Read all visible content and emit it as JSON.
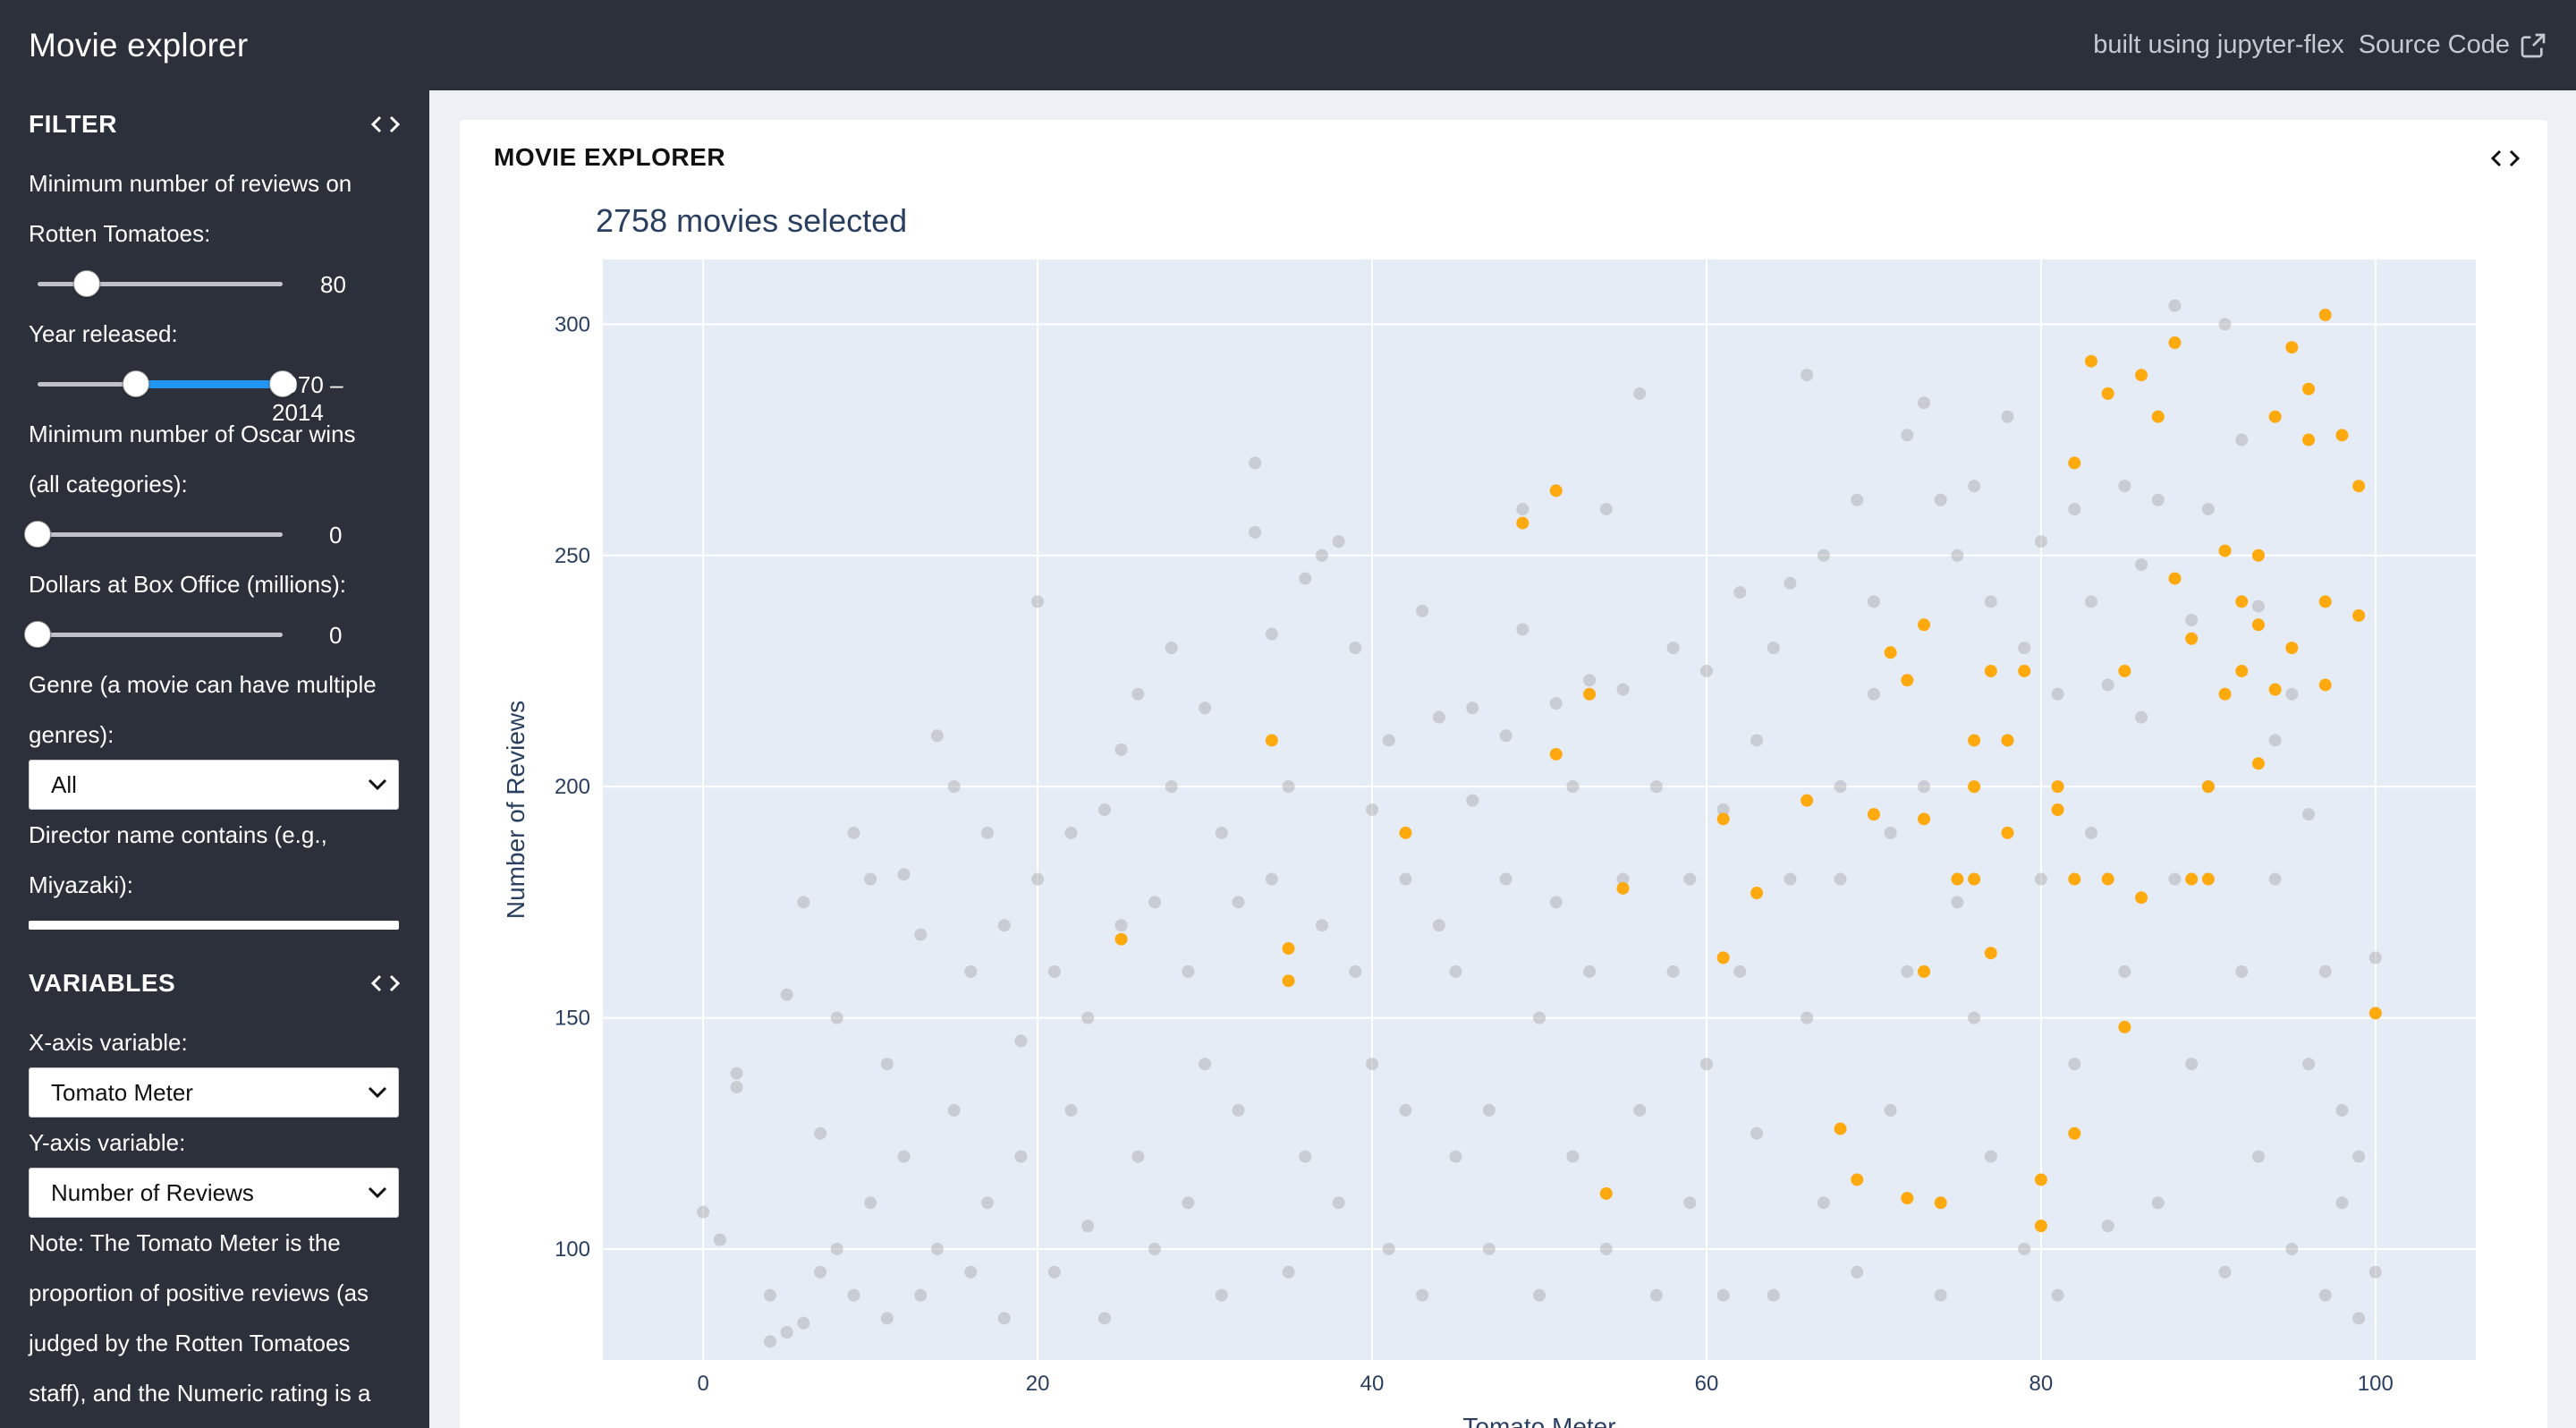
{
  "header": {
    "title": "Movie explorer",
    "built_using": "built using jupyter-flex",
    "source_code": "Source Code"
  },
  "sidebar": {
    "filter": {
      "heading": "FILTER",
      "reviews_label_1": "Minimum number of reviews on",
      "reviews_label_2": "Rotten Tomatoes:",
      "reviews_value": "80",
      "reviews_fraction": 0.2,
      "year_label": "Year released:",
      "year_value": "1970 – 2014",
      "year_low_fraction": 0.4,
      "year_high_fraction": 1.0,
      "oscars_label_1": "Minimum number of Oscar wins",
      "oscars_label_2": "(all categories):",
      "oscars_value": "0",
      "oscars_fraction": 0,
      "boxoffice_label": "Dollars at Box Office (millions):",
      "boxoffice_value": "0",
      "boxoffice_fraction": 0,
      "genre_label_1": "Genre (a movie can have multiple",
      "genre_label_2": "genres):",
      "genre_value": "All",
      "director_label_1": "Director name contains (e.g.,",
      "director_label_2": "Miyazaki):",
      "director_value": ""
    },
    "variables": {
      "heading": "VARIABLES",
      "x_label": "X-axis variable:",
      "x_value": "Tomato Meter",
      "y_label": "Y-axis variable:",
      "y_value": "Number of Reviews",
      "note_1": "Note: The Tomato Meter is the",
      "note_2": "proportion of positive reviews (as",
      "note_3": "judged by the Rotten Tomatoes",
      "note_4": "staff), and the Numeric rating is a"
    }
  },
  "main": {
    "card_title": "MOVIE EXPLORER",
    "plot_title": "2758 movies selected"
  },
  "colors": {
    "topbar": "#2b303b",
    "plot_bg": "#e5ecf6",
    "point_grey": "#a6a6a6",
    "point_orange": "#ffa500",
    "slider_fill": "#2196f3"
  },
  "chart_data": {
    "type": "scatter",
    "title": "2758 movies selected",
    "xlabel": "Tomato Meter",
    "ylabel": "Number of Reviews",
    "xlim": [
      -6,
      106
    ],
    "ylim": [
      76,
      314
    ],
    "xticks": [
      0,
      20,
      40,
      60,
      80,
      100
    ],
    "yticks": [
      100,
      150,
      200,
      250,
      300
    ],
    "grid": true,
    "series": [
      {
        "color": "#a6a6a6",
        "points": [
          [
            0,
            108
          ],
          [
            1,
            102
          ],
          [
            2,
            135
          ],
          [
            2,
            138
          ],
          [
            4,
            90
          ],
          [
            4,
            80
          ],
          [
            5,
            82
          ],
          [
            5,
            155
          ],
          [
            6,
            84
          ],
          [
            6,
            175
          ],
          [
            7,
            95
          ],
          [
            7,
            125
          ],
          [
            8,
            100
          ],
          [
            8,
            150
          ],
          [
            9,
            90
          ],
          [
            9,
            190
          ],
          [
            10,
            110
          ],
          [
            10,
            180
          ],
          [
            11,
            85
          ],
          [
            11,
            140
          ],
          [
            12,
            120
          ],
          [
            12,
            181
          ],
          [
            13,
            168
          ],
          [
            13,
            90
          ],
          [
            14,
            211
          ],
          [
            14,
            100
          ],
          [
            15,
            130
          ],
          [
            15,
            200
          ],
          [
            16,
            160
          ],
          [
            16,
            95
          ],
          [
            17,
            110
          ],
          [
            17,
            190
          ],
          [
            18,
            85
          ],
          [
            18,
            170
          ],
          [
            19,
            145
          ],
          [
            19,
            120
          ],
          [
            20,
            180
          ],
          [
            20,
            240
          ],
          [
            21,
            95
          ],
          [
            21,
            160
          ],
          [
            22,
            130
          ],
          [
            22,
            190
          ],
          [
            23,
            105
          ],
          [
            23,
            150
          ],
          [
            24,
            195
          ],
          [
            24,
            85
          ],
          [
            25,
            170
          ],
          [
            25,
            208
          ],
          [
            26,
            120
          ],
          [
            26,
            220
          ],
          [
            27,
            100
          ],
          [
            27,
            175
          ],
          [
            28,
            230
          ],
          [
            28,
            200
          ],
          [
            29,
            110
          ],
          [
            29,
            160
          ],
          [
            30,
            217
          ],
          [
            30,
            140
          ],
          [
            31,
            90
          ],
          [
            31,
            190
          ],
          [
            32,
            175
          ],
          [
            32,
            130
          ],
          [
            33,
            270
          ],
          [
            33,
            255
          ],
          [
            34,
            233
          ],
          [
            34,
            180
          ],
          [
            35,
            95
          ],
          [
            35,
            200
          ],
          [
            36,
            120
          ],
          [
            36,
            245
          ],
          [
            37,
            250
          ],
          [
            37,
            170
          ],
          [
            38,
            110
          ],
          [
            38,
            253
          ],
          [
            39,
            230
          ],
          [
            39,
            160
          ],
          [
            40,
            140
          ],
          [
            40,
            195
          ],
          [
            41,
            100
          ],
          [
            41,
            210
          ],
          [
            42,
            180
          ],
          [
            42,
            130
          ],
          [
            43,
            238
          ],
          [
            43,
            90
          ],
          [
            44,
            170
          ],
          [
            44,
            215
          ],
          [
            45,
            120
          ],
          [
            45,
            160
          ],
          [
            46,
            197
          ],
          [
            46,
            217
          ],
          [
            47,
            130
          ],
          [
            47,
            100
          ],
          [
            48,
            180
          ],
          [
            48,
            211
          ],
          [
            49,
            234
          ],
          [
            49,
            260
          ],
          [
            50,
            150
          ],
          [
            50,
            90
          ],
          [
            51,
            218
          ],
          [
            51,
            175
          ],
          [
            52,
            120
          ],
          [
            52,
            200
          ],
          [
            53,
            223
          ],
          [
            53,
            160
          ],
          [
            54,
            100
          ],
          [
            54,
            260
          ],
          [
            55,
            180
          ],
          [
            55,
            221
          ],
          [
            56,
            285
          ],
          [
            56,
            130
          ],
          [
            57,
            200
          ],
          [
            57,
            90
          ],
          [
            58,
            230
          ],
          [
            58,
            160
          ],
          [
            59,
            110
          ],
          [
            59,
            180
          ],
          [
            60,
            225
          ],
          [
            60,
            140
          ],
          [
            61,
            90
          ],
          [
            61,
            195
          ],
          [
            62,
            242
          ],
          [
            62,
            160
          ],
          [
            63,
            125
          ],
          [
            63,
            210
          ],
          [
            64,
            230
          ],
          [
            64,
            90
          ],
          [
            65,
            244
          ],
          [
            65,
            180
          ],
          [
            66,
            289
          ],
          [
            66,
            150
          ],
          [
            67,
            250
          ],
          [
            67,
            110
          ],
          [
            68,
            200
          ],
          [
            68,
            180
          ],
          [
            69,
            262
          ],
          [
            69,
            95
          ],
          [
            70,
            240
          ],
          [
            70,
            220
          ],
          [
            71,
            190
          ],
          [
            71,
            130
          ],
          [
            72,
            276
          ],
          [
            72,
            160
          ],
          [
            73,
            283
          ],
          [
            73,
            200
          ],
          [
            74,
            262
          ],
          [
            74,
            90
          ],
          [
            75,
            250
          ],
          [
            75,
            175
          ],
          [
            76,
            265
          ],
          [
            76,
            150
          ],
          [
            77,
            240
          ],
          [
            77,
            120
          ],
          [
            78,
            280
          ],
          [
            78,
            210
          ],
          [
            79,
            230
          ],
          [
            79,
            100
          ],
          [
            80,
            253
          ],
          [
            80,
            180
          ],
          [
            81,
            220
          ],
          [
            81,
            90
          ],
          [
            82,
            260
          ],
          [
            82,
            140
          ],
          [
            83,
            240
          ],
          [
            83,
            190
          ],
          [
            84,
            222
          ],
          [
            84,
            105
          ],
          [
            85,
            265
          ],
          [
            85,
            160
          ],
          [
            86,
            248
          ],
          [
            86,
            215
          ],
          [
            87,
            262
          ],
          [
            87,
            110
          ],
          [
            88,
            304
          ],
          [
            88,
            180
          ],
          [
            89,
            236
          ],
          [
            89,
            140
          ],
          [
            90,
            260
          ],
          [
            90,
            200
          ],
          [
            91,
            300
          ],
          [
            91,
            95
          ],
          [
            92,
            275
          ],
          [
            92,
            160
          ],
          [
            93,
            239
          ],
          [
            93,
            120
          ],
          [
            94,
            210
          ],
          [
            94,
            180
          ],
          [
            95,
            220
          ],
          [
            95,
            100
          ],
          [
            96,
            194
          ],
          [
            96,
            140
          ],
          [
            97,
            160
          ],
          [
            97,
            90
          ],
          [
            98,
            110
          ],
          [
            98,
            130
          ],
          [
            99,
            120
          ],
          [
            99,
            85
          ],
          [
            100,
            163
          ],
          [
            100,
            95
          ]
        ]
      },
      {
        "color": "#ffa500",
        "points": [
          [
            25,
            167
          ],
          [
            34,
            210
          ],
          [
            35,
            158
          ],
          [
            35,
            165
          ],
          [
            42,
            190
          ],
          [
            49,
            257
          ],
          [
            51,
            264
          ],
          [
            51,
            207
          ],
          [
            53,
            220
          ],
          [
            54,
            112
          ],
          [
            55,
            178
          ],
          [
            61,
            193
          ],
          [
            61,
            163
          ],
          [
            63,
            177
          ],
          [
            66,
            197
          ],
          [
            68,
            126
          ],
          [
            69,
            115
          ],
          [
            70,
            194
          ],
          [
            71,
            229
          ],
          [
            72,
            111
          ],
          [
            72,
            223
          ],
          [
            73,
            235
          ],
          [
            73,
            193
          ],
          [
            73,
            160
          ],
          [
            74,
            110
          ],
          [
            75,
            180
          ],
          [
            76,
            180
          ],
          [
            76,
            210
          ],
          [
            76,
            200
          ],
          [
            77,
            164
          ],
          [
            77,
            225
          ],
          [
            78,
            210
          ],
          [
            78,
            190
          ],
          [
            79,
            225
          ],
          [
            80,
            115
          ],
          [
            80,
            105
          ],
          [
            81,
            200
          ],
          [
            81,
            195
          ],
          [
            82,
            125
          ],
          [
            82,
            180
          ],
          [
            82,
            270
          ],
          [
            83,
            292
          ],
          [
            84,
            285
          ],
          [
            84,
            180
          ],
          [
            85,
            148
          ],
          [
            85,
            225
          ],
          [
            86,
            176
          ],
          [
            86,
            289
          ],
          [
            87,
            280
          ],
          [
            88,
            296
          ],
          [
            88,
            245
          ],
          [
            89,
            232
          ],
          [
            89,
            180
          ],
          [
            90,
            200
          ],
          [
            90,
            180
          ],
          [
            91,
            251
          ],
          [
            91,
            220
          ],
          [
            92,
            240
          ],
          [
            92,
            225
          ],
          [
            93,
            205
          ],
          [
            93,
            250
          ],
          [
            93,
            235
          ],
          [
            94,
            280
          ],
          [
            94,
            221
          ],
          [
            95,
            295
          ],
          [
            95,
            230
          ],
          [
            96,
            275
          ],
          [
            96,
            286
          ],
          [
            97,
            302
          ],
          [
            97,
            240
          ],
          [
            97,
            222
          ],
          [
            98,
            276
          ],
          [
            99,
            265
          ],
          [
            99,
            237
          ],
          [
            100,
            151
          ]
        ]
      }
    ]
  }
}
